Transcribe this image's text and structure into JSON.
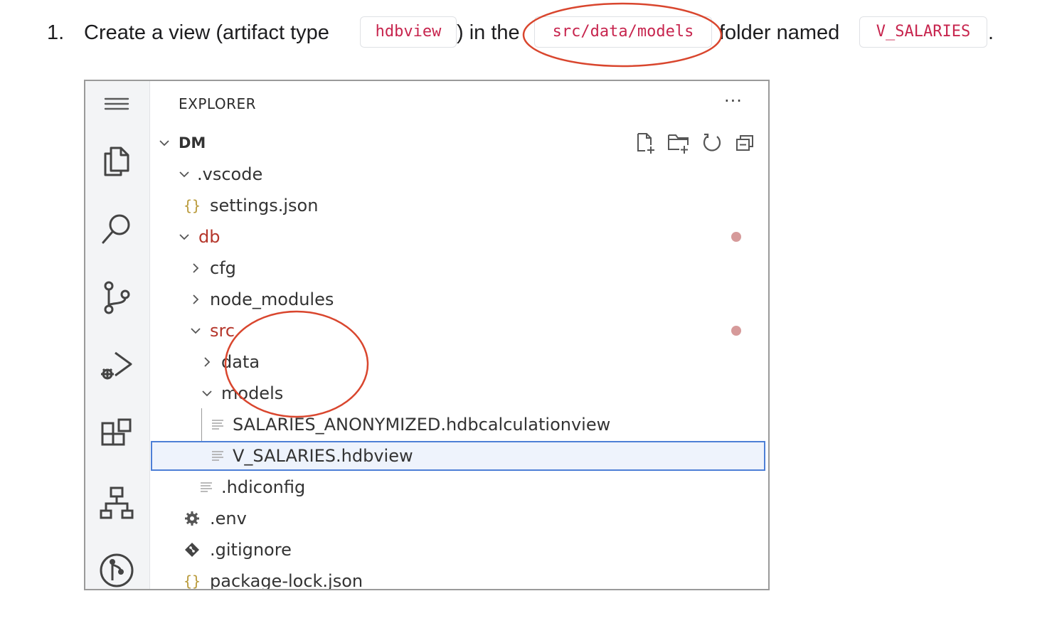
{
  "instruction": {
    "number": "1.",
    "prefix": "Create a view (artifact type",
    "artifact_type": "hdbview",
    "middle": ") in the",
    "folder": "src/data/models",
    "suffix": "folder named",
    "view_name": "V_SALARIES",
    "end": "."
  },
  "explorer": {
    "title": "EXPLORER",
    "more": "···",
    "root": "DM",
    "toolbar": [
      "new-file-icon",
      "new-folder-icon",
      "refresh-icon",
      "collapse-all-icon"
    ],
    "activity_bar": [
      "menu-icon",
      "files-icon",
      "search-icon",
      "source-control-icon",
      "run-debug-icon",
      "extensions-icon",
      "hierarchy-icon",
      "git-graph-icon"
    ],
    "tree": {
      "vscode": ".vscode",
      "settings": "settings.json",
      "db": "db",
      "cfg": "cfg",
      "node_modules": "node_modules",
      "src": "src",
      "data": "data",
      "models": "models",
      "calc_view": "SALARIES_ANONYMIZED.hdbcalculationview",
      "hdbview": "V_SALARIES.hdbview",
      "hdiconfig": ".hdiconfig",
      "env": ".env",
      "gitignore": ".gitignore",
      "package_lock": "package-lock.json"
    },
    "modified_dot_color": "#d69a9a",
    "folder_text_color": "#b5362b",
    "selection_border": "#4d7fd6"
  },
  "annotation_color": "#d9462e"
}
